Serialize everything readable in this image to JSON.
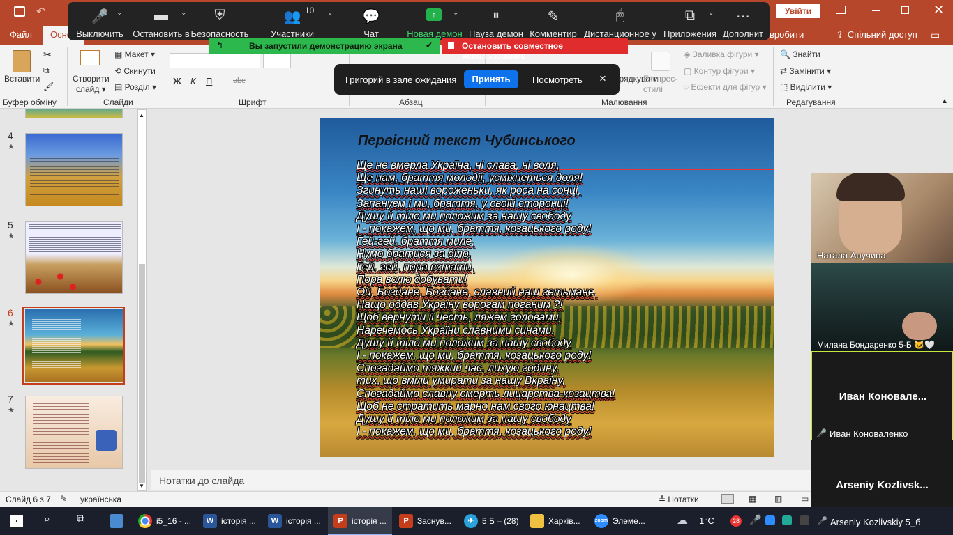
{
  "app": {
    "save_icon": "save-icon",
    "signin_label": "Увійти",
    "share_label": "Спільний доступ",
    "accent": "#b7472a"
  },
  "tabs": {
    "file": "Файл",
    "home": "Основ",
    "draw_partial": "вробити"
  },
  "ribbon": {
    "paste": "Вставити",
    "clipboard_group": "Буфер обміну",
    "new_slide_line1": "Створити",
    "new_slide_line2": "слайд",
    "layout": "Макет",
    "reset": "Скинути",
    "section": "Розділ",
    "slides_group": "Слайди",
    "font_group": "Шрифт",
    "bold": "Ж",
    "italic": "К",
    "underline": "П",
    "strike": "abc",
    "paragraph_group": "Абзац",
    "drawing_group": "Малювання",
    "arrange_partial": "впорядкувати",
    "quick_styles_line1": "Експрес-",
    "quick_styles_line2": "стилі",
    "shape_fill": "Заливка фігури",
    "shape_outline": "Контур фігури",
    "shape_effects": "Ефекти для фігур",
    "find": "Знайти",
    "replace": "Замінити",
    "select": "Виділити",
    "editing_group": "Редагування"
  },
  "zoom_toolbar": {
    "mute": "Выключить",
    "video": "Остановить в",
    "security": "Безопасность",
    "participants": "Участники",
    "participants_count": "10",
    "chat": "Чат",
    "new_share": "Новая демон",
    "pause_share": "Пауза демон",
    "annotate": "Комментир",
    "remote_control": "Дистанционное у",
    "apps": "Приложения",
    "more": "Дополнит",
    "sharing_banner": "Вы запустили демонстрацию экрана",
    "stop_share": "Остановить совместное использование",
    "waiting_text": "Григорий в зале ожидания",
    "admit": "Принять",
    "see": "Посмотреть",
    "close": "×"
  },
  "thumbnails": [
    {
      "num": "4",
      "star": "★"
    },
    {
      "num": "5",
      "star": "★"
    },
    {
      "num": "6",
      "star": "★"
    },
    {
      "num": "7",
      "star": "★"
    }
  ],
  "slide": {
    "title": "Первісний текст Чубинського",
    "lines": [
      "Ще не вмерла Україна, ні слава, ні воля,",
      "Ще нам, браття молодії, усміхнеться доля!",
      "Згинуть наші вороженьки, як роса на сонці,",
      "Запануєм і ми, браття, у своїй сторонці!",
      "Душу й тіло ми положим за нашу свободу",
      "І - покажем, що ми, браття, козацького роду!",
      "Гей-гей, браття миле,",
      "Нумо братися за діло,",
      "Гей, гей, пора встати,",
      "Пора волю добувати!",
      "Ой, Богдане, Богдане, славний наш гетьмане,",
      "Нащо оддав Україну ворогам поганим ?!",
      "Щоб вернути її честь, ляжем головами,",
      "Наречемось України славними синами.",
      "Душу й тіло ми положим за нашу свободу",
      "І - покажем, що ми, браття, козацького роду!",
      "Спогадаймо тяжкий час, лихую годину,",
      "тих, що вміли умирати за нашу Вкраїну,",
      "Спогадаймо славну смерть лицарства-козацтва!",
      "Щоб не стратить марно нам свого юнацтва!",
      "Душу й тіло ми положим за нашу свободу",
      "І - покажем, що ми, браття, козацького роду!"
    ]
  },
  "notes_placeholder": "Нотатки до слайда",
  "status": {
    "slide_counter": "Слайд 6 з 7",
    "language": "українська",
    "notes_button": "Нотатки"
  },
  "video": {
    "p1": "Натала Анучина",
    "p2": "Милана Бондаренко 5-Б 🐱🤍",
    "p3_big": "Иван  Коновале...",
    "p3": "Иван Коноваленко",
    "p4_big": "Arseniy  Kozlivsk...",
    "p4": "Arseniy Kozlivskiy 5_б"
  },
  "taskbar": {
    "apps": [
      {
        "label": "i5_16 - ..."
      },
      {
        "label": "історія ..."
      },
      {
        "label": "історія ..."
      },
      {
        "label": "історія ..."
      },
      {
        "label": "Заснув..."
      },
      {
        "label": "5 Б – (28)"
      },
      {
        "label": "Харків..."
      },
      {
        "label": "Элеме..."
      }
    ],
    "weather": "1°C",
    "notif_badge": "28"
  }
}
